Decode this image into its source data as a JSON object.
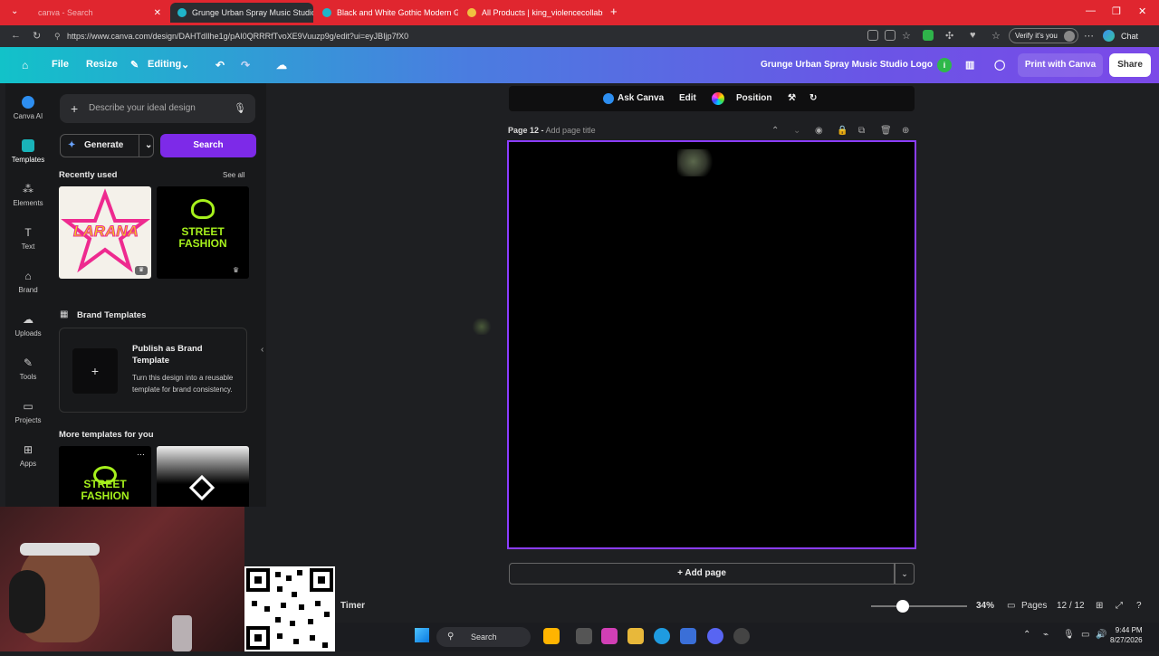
{
  "browser": {
    "tabs": [
      {
        "label": "canva - Search"
      },
      {
        "label": "Grunge Urban Spray Music Studio"
      },
      {
        "label": "Black and White Gothic Modern G"
      },
      {
        "label": "All Products | king_violencecollabs"
      }
    ],
    "url": "https://www.canva.com/design/DAHTdIlhe1g/pAI0QRRRfTvoXE9Vuuzp9g/edit?ui=eyJBIjp7fX0",
    "verify_label": "Verify it's you",
    "chat_label": "Chat"
  },
  "header": {
    "file": "File",
    "resize": "Resize",
    "editing": "Editing",
    "design_title": "Grunge Urban Spray Music Studio Logo",
    "print": "Print with Canva",
    "share": "Share",
    "brand_color": "#7b49e8"
  },
  "rail": [
    {
      "label": "Canva AI",
      "icon": "canva-ai-icon"
    },
    {
      "label": "Templates",
      "icon": "templates-icon"
    },
    {
      "label": "Elements",
      "icon": "elements-icon"
    },
    {
      "label": "Text",
      "icon": "text-icon"
    },
    {
      "label": "Brand",
      "icon": "brand-icon"
    },
    {
      "label": "Uploads",
      "icon": "uploads-icon"
    },
    {
      "label": "Tools",
      "icon": "tools-icon"
    },
    {
      "label": "Projects",
      "icon": "projects-icon"
    },
    {
      "label": "Apps",
      "icon": "apps-icon"
    }
  ],
  "panel": {
    "describe_placeholder": "Describe your ideal design",
    "generate": "Generate",
    "search": "Search",
    "recently_used": "Recently used",
    "see_all": "See all",
    "brand_templates": "Brand Templates",
    "publish_title": "Publish as Brand Template",
    "publish_desc": "Turn this design into a reusable template for brand consistency.",
    "more_templates": "More templates for you",
    "thumb1_text": "LARANA",
    "thumb2_text": "STREET FASHION",
    "thumb3_text": "STREET FASHION"
  },
  "toolbar": {
    "ask_canva": "Ask Canva",
    "edit": "Edit",
    "position": "Position"
  },
  "page": {
    "label": "Page 12 -",
    "title_placeholder": "Add page title",
    "add_page": "+ Add page"
  },
  "bottom": {
    "timer": "Timer",
    "zoom": "34%",
    "zoom_fraction": 0.34,
    "pages": "Pages",
    "page_count": "12 / 12"
  },
  "taskbar": {
    "search": "Search",
    "time": "9:44 PM",
    "date": "8/27/2026"
  }
}
